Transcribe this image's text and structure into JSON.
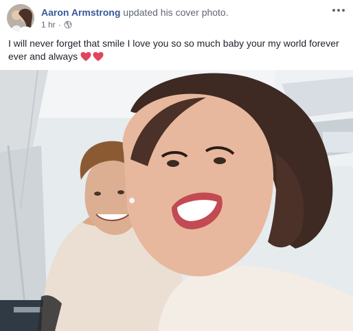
{
  "post": {
    "author": {
      "name": "Aaron Armstrong",
      "action": "updated his cover photo."
    },
    "meta": {
      "time": "1 hr",
      "separator": "·",
      "privacy_icon": "globe-icon"
    },
    "menu_icon": "more-horizontal-icon",
    "text": "I will never forget that smile I love you so so much baby your my world forever ever and always",
    "emoji": [
      "heart-icon",
      "heart-icon"
    ],
    "photo": {
      "icon": "cover-photo",
      "description_colors": {
        "link": "#365899",
        "muted": "#616770",
        "heart": "#e0445e"
      }
    }
  }
}
